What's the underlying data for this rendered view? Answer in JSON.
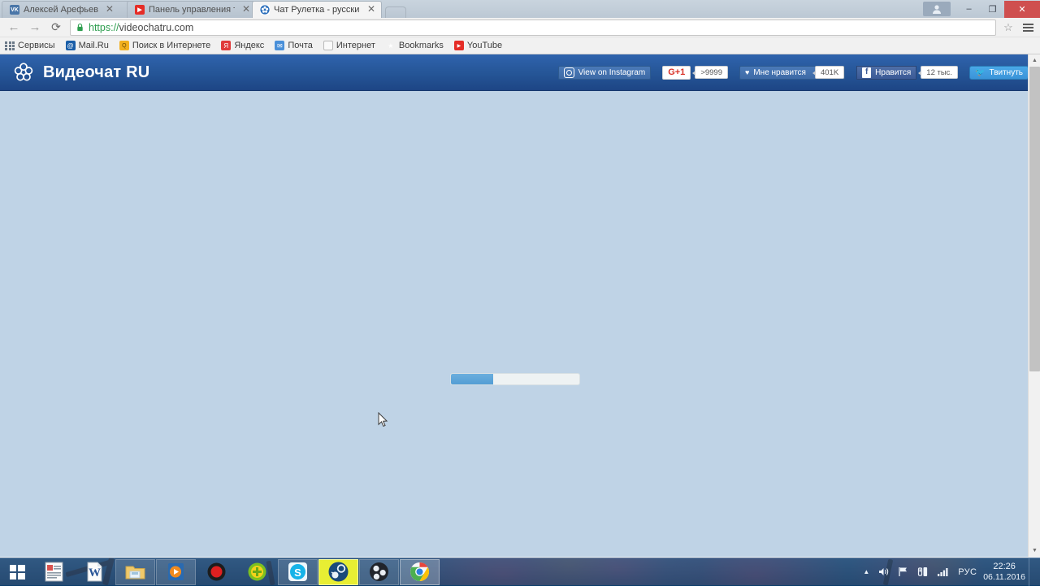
{
  "window": {
    "controls": {
      "avatar": "user-avatar",
      "minimize": "–",
      "maximize": "❐",
      "close": "✕"
    }
  },
  "tabs": [
    {
      "title": "Алексей Арефьев",
      "favicon": "vk-icon",
      "favicon_text": "VK",
      "active": false,
      "close": "✕"
    },
    {
      "title": "Панель управления тран",
      "favicon": "youtube-icon",
      "favicon_text": "▶",
      "active": false,
      "close": "✕"
    },
    {
      "title": "Чат Рулетка - русский ви",
      "favicon": "videochat-icon",
      "favicon_text": "",
      "active": true,
      "close": "✕"
    }
  ],
  "toolbar": {
    "back": "←",
    "forward": "→",
    "reload": "⟳",
    "url_scheme": "https://",
    "url_rest": "videochatru.com",
    "url_full": "https://videochatru.com",
    "lock": "secure-lock-icon",
    "star": "☆",
    "menu": "chrome-menu-icon"
  },
  "bookmarks": [
    {
      "label": "Сервисы",
      "icon": "apps-grid-icon"
    },
    {
      "label": "Mail.Ru",
      "icon": "mailru-icon",
      "glyph": "@"
    },
    {
      "label": "Поиск в Интернете",
      "icon": "search-icon",
      "glyph": "🔍"
    },
    {
      "label": "Яндекс",
      "icon": "yandex-icon",
      "glyph": "Я"
    },
    {
      "label": "Почта",
      "icon": "mail-envelope-icon",
      "glyph": "✉"
    },
    {
      "label": "Интернет",
      "icon": "page-icon",
      "glyph": "▤"
    },
    {
      "label": "Bookmarks",
      "icon": "star-icon",
      "glyph": "★"
    },
    {
      "label": "YouTube",
      "icon": "youtube-icon",
      "glyph": "▶"
    }
  ],
  "site": {
    "brand": "Видеочат RU",
    "logo": "flower-cluster-logo",
    "social": {
      "instagram": {
        "label": "View on Instagram",
        "icon": "instagram-icon"
      },
      "googleplus": {
        "label": "G+1",
        "count": ">9999",
        "icon": "googleplus-icon"
      },
      "vk": {
        "label": "Мне нравится",
        "count": "401K",
        "icon": "heart-icon"
      },
      "facebook": {
        "label": "Нравится",
        "count": "12 тыс.",
        "icon": "facebook-icon"
      },
      "twitter": {
        "label": "Твитнуть",
        "icon": "twitter-bird-icon"
      }
    },
    "loading": {
      "percent": 33,
      "label": "loading-progress-bar"
    }
  },
  "scrollbar": {
    "up": "▲",
    "down": "▼"
  },
  "taskbar": {
    "start": "windows-start-icon",
    "items": [
      {
        "name": "abbyy-screenshot",
        "state": "plain"
      },
      {
        "name": "microsoft-word",
        "state": "plain"
      },
      {
        "name": "file-explorer",
        "state": "pinned"
      },
      {
        "name": "media-player",
        "state": "pinned"
      },
      {
        "name": "record-button-app",
        "state": "plain"
      },
      {
        "name": "green-plus-app",
        "state": "plain"
      },
      {
        "name": "skype",
        "state": "pinned"
      },
      {
        "name": "steam",
        "state": "hot"
      },
      {
        "name": "obs-studio",
        "state": "pinned"
      },
      {
        "name": "google-chrome",
        "state": "active"
      }
    ],
    "tray": {
      "show_hidden": "▲",
      "volume": "speaker-icon",
      "flag": "action-center-flag-icon",
      "network": "network-icon",
      "signal": "signal-bars-icon",
      "language": "РУС",
      "time": "22:26",
      "date": "06.11.2016"
    }
  }
}
